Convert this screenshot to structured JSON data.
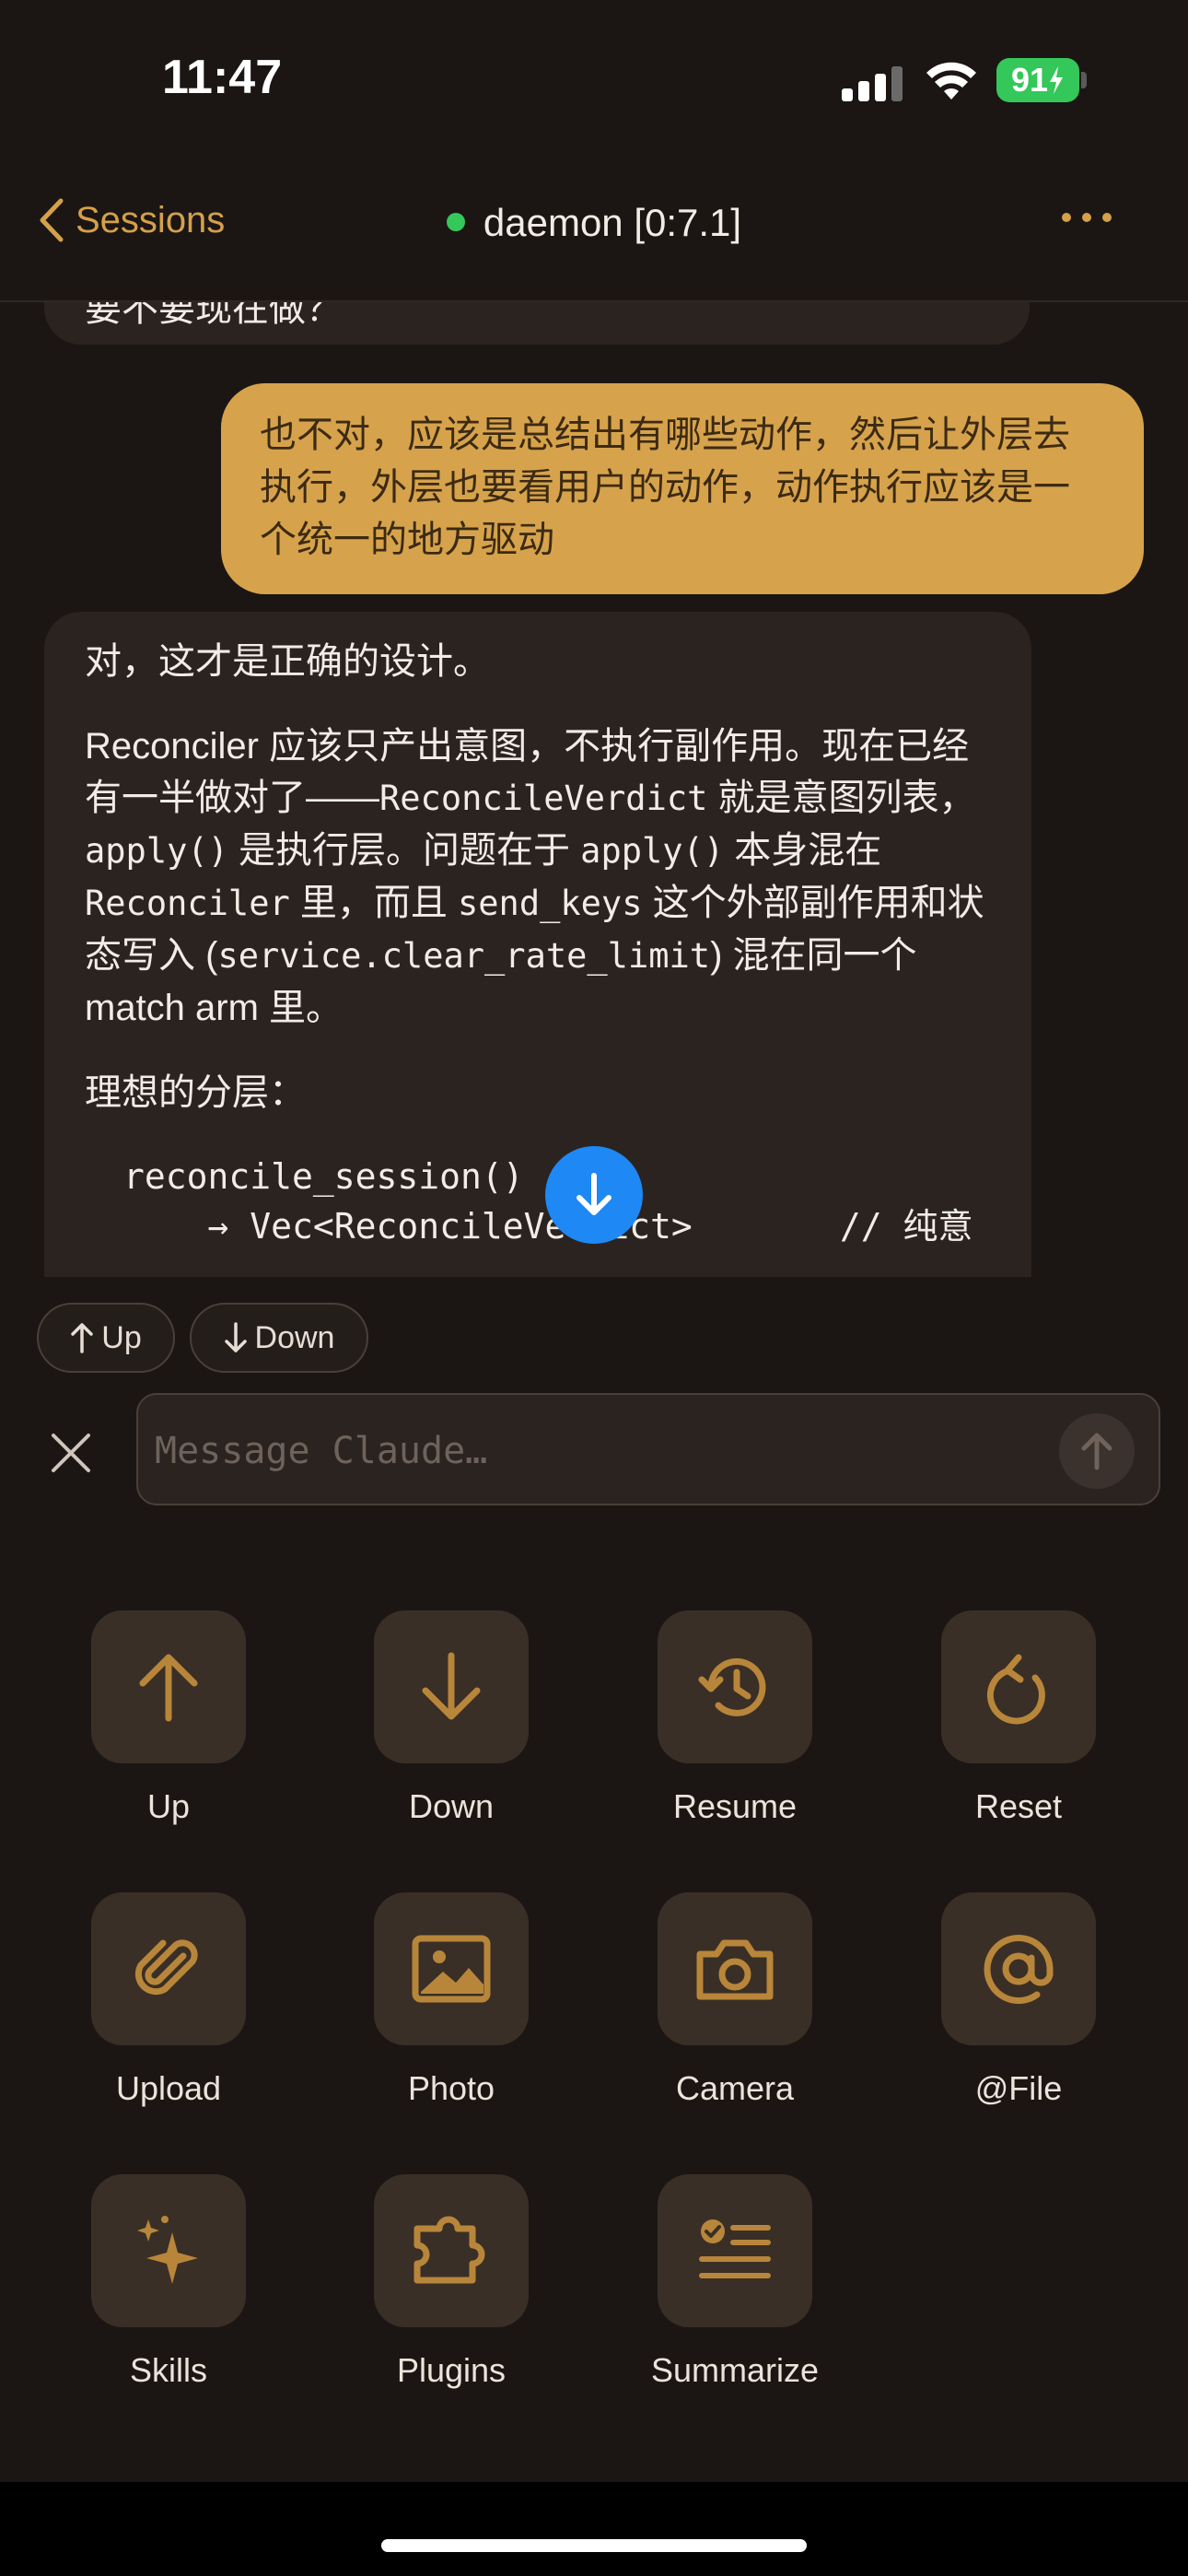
{
  "status_bar": {
    "time": "11:47",
    "battery": "91"
  },
  "nav": {
    "back_label": "Sessions",
    "title": "daemon [0:7.1]",
    "status_color": "#34c759"
  },
  "chat": {
    "previous_assistant_fragment": "要不要现在做？",
    "user_message": "也不对，应该是总结出有哪些动作，然后让外层去执行，外层也要看用户的动作，动作执行应该是一个统一的地方驱动",
    "assistant": {
      "p1": "对，这才是正确的设计。",
      "p2_a": "Reconciler 应该只产出意图，不执行副作用。现在已经有一半做对了——",
      "p2_code1": "ReconcileVerdict",
      "p2_b": " 就是意图列表，",
      "p2_code2": "apply()",
      "p2_c": " 是执行层。问题在于 ",
      "p2_code3": "apply()",
      "p2_d": " 本身混在 ",
      "p2_code4": "Reconciler",
      "p2_e": " 里，而且 ",
      "p2_code5": "send_keys",
      "p2_f": " 这个外部副作用和状态写入 (",
      "p2_code6": "service.clear_rate_limit",
      "p2_g": ") 混在同一个 match arm 里。",
      "p3": "理想的分层：",
      "code_line1": "reconcile_session()",
      "code_line2": "    → Vec<ReconcileVerdict>       // 纯意"
    }
  },
  "pills": {
    "up": "Up",
    "down": "Down"
  },
  "composer": {
    "placeholder": "Message Claude…"
  },
  "actions": [
    {
      "label": "Up",
      "icon": "arrow-up-icon"
    },
    {
      "label": "Down",
      "icon": "arrow-down-icon"
    },
    {
      "label": "Resume",
      "icon": "history-icon"
    },
    {
      "label": "Reset",
      "icon": "reset-icon"
    },
    {
      "label": "Upload",
      "icon": "paperclip-icon"
    },
    {
      "label": "Photo",
      "icon": "photo-icon"
    },
    {
      "label": "Camera",
      "icon": "camera-icon"
    },
    {
      "label": "@File",
      "icon": "at-icon"
    },
    {
      "label": "Skills",
      "icon": "sparkles-icon"
    },
    {
      "label": "Plugins",
      "icon": "puzzle-icon"
    },
    {
      "label": "Summarize",
      "icon": "summarize-icon"
    }
  ],
  "colors": {
    "accent": "#d4a04a",
    "user_bubble": "#d6a34c",
    "fab": "#1e88f5"
  }
}
